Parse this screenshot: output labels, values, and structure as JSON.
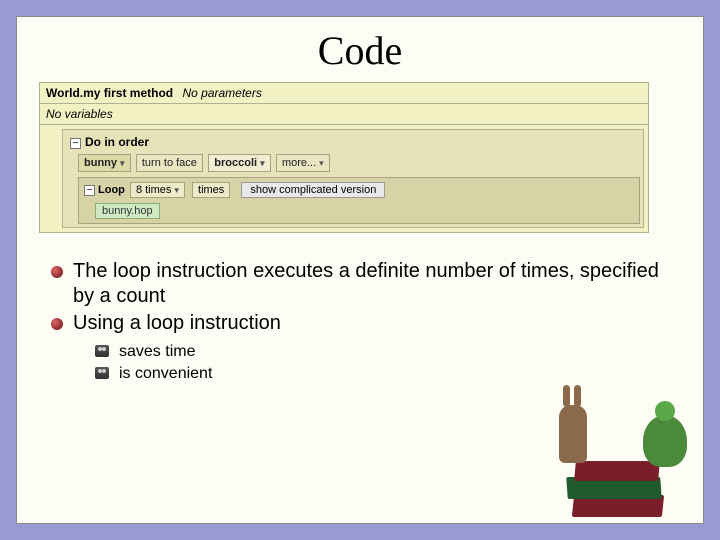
{
  "title": "Code",
  "code": {
    "method_owner": "World.",
    "method_name": "my first method",
    "params_label": "No parameters",
    "vars_label": "No variables",
    "do_in_order": "Do in order",
    "turn_row": {
      "object": "bunny",
      "action": "turn to face",
      "target": "broccoli",
      "more": "more..."
    },
    "loop": {
      "label": "Loop",
      "count": "8 times",
      "times_label": "times",
      "button": "show complicated version",
      "call": "bunny.hop"
    }
  },
  "bullets": {
    "b1": "The loop instruction executes a definite number of times, specified by a count",
    "b2": "Using a loop instruction",
    "sub1": "saves time",
    "sub2": "is convenient"
  }
}
